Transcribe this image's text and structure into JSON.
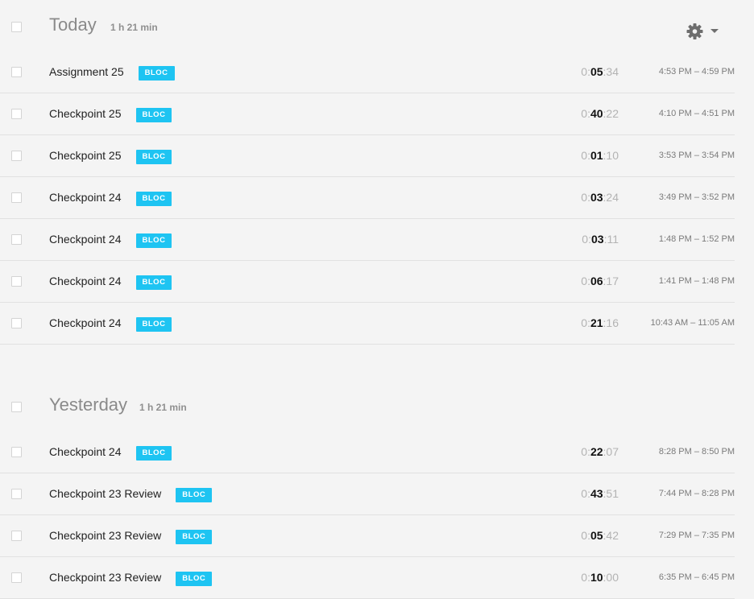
{
  "groups": [
    {
      "title": "Today",
      "total": "1 h 21 min",
      "entries": [
        {
          "label": "Assignment 25",
          "tag": "BLOC",
          "h": "0",
          "m": "05",
          "s": "34",
          "range": "4:53 PM – 4:59 PM"
        },
        {
          "label": "Checkpoint 25",
          "tag": "BLOC",
          "h": "0",
          "m": "40",
          "s": "22",
          "range": "4:10 PM – 4:51 PM"
        },
        {
          "label": "Checkpoint 25",
          "tag": "BLOC",
          "h": "0",
          "m": "01",
          "s": "10",
          "range": "3:53 PM – 3:54 PM"
        },
        {
          "label": "Checkpoint 24",
          "tag": "BLOC",
          "h": "0",
          "m": "03",
          "s": "24",
          "range": "3:49 PM – 3:52 PM"
        },
        {
          "label": "Checkpoint 24",
          "tag": "BLOC",
          "h": "0",
          "m": "03",
          "s": "11",
          "range": "1:48 PM – 1:52 PM"
        },
        {
          "label": "Checkpoint 24",
          "tag": "BLOC",
          "h": "0",
          "m": "06",
          "s": "17",
          "range": "1:41 PM – 1:48 PM"
        },
        {
          "label": "Checkpoint 24",
          "tag": "BLOC",
          "h": "0",
          "m": "21",
          "s": "16",
          "range": "10:43 AM – 11:05 AM"
        }
      ]
    },
    {
      "title": "Yesterday",
      "total": "1 h 21 min",
      "entries": [
        {
          "label": "Checkpoint 24",
          "tag": "BLOC",
          "h": "0",
          "m": "22",
          "s": "07",
          "range": "8:28 PM – 8:50 PM"
        },
        {
          "label": "Checkpoint 23 Review",
          "tag": "BLOC",
          "h": "0",
          "m": "43",
          "s": "51",
          "range": "7:44 PM – 8:28 PM"
        },
        {
          "label": "Checkpoint 23 Review",
          "tag": "BLOC",
          "h": "0",
          "m": "05",
          "s": "42",
          "range": "7:29 PM – 7:35 PM"
        },
        {
          "label": "Checkpoint 23 Review",
          "tag": "BLOC",
          "h": "0",
          "m": "10",
          "s": "00",
          "range": "6:35 PM – 6:45 PM"
        }
      ]
    }
  ],
  "settings": {
    "icon": "gear-icon",
    "dropdown_icon": "caret-down-icon"
  },
  "colors": {
    "tag": "#1ec4f2",
    "background": "#f4f4f4"
  }
}
